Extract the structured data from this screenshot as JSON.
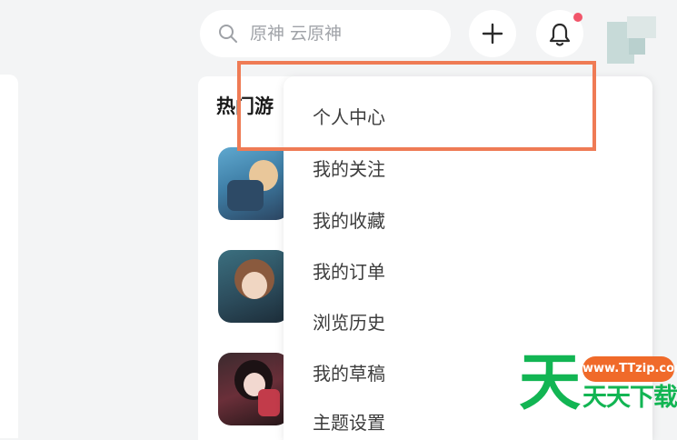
{
  "search": {
    "placeholder": "原神 云原神",
    "icon": "search-icon"
  },
  "header": {
    "create_icon": "plus-icon",
    "notifications_icon": "bell-icon",
    "has_unread": true,
    "avatar": "user-avatar"
  },
  "hot_games": {
    "title": "热门游",
    "items": [
      {
        "icon": "game-icon-1"
      },
      {
        "icon": "game-icon-2"
      },
      {
        "icon": "game-icon-3"
      }
    ]
  },
  "menu": {
    "items": [
      {
        "label": "个人中心"
      },
      {
        "label": "我的关注"
      },
      {
        "label": "我的收藏"
      },
      {
        "label": "我的订单"
      },
      {
        "label": "浏览历史"
      },
      {
        "label": "我的草稿"
      },
      {
        "label": "主题设置"
      }
    ],
    "highlighted_index": 0
  },
  "watermark": {
    "logo_char": "天",
    "url": "www.TTzip.com",
    "name": "天天下载"
  },
  "colors": {
    "highlight": "#ef7b55",
    "notification_dot": "#f1556a",
    "watermark_green": "#12b553",
    "watermark_orange": "#f06a2a"
  }
}
